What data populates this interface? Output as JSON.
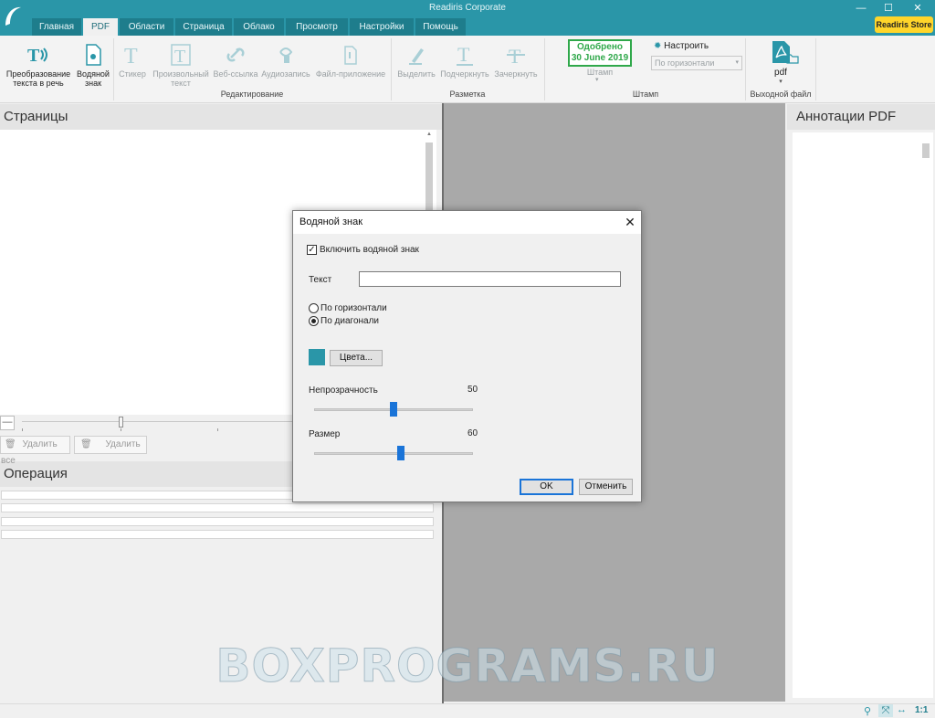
{
  "app": {
    "title": "Readiris Corporate",
    "store": "Readiris Store"
  },
  "tabs": [
    "Главная",
    "PDF",
    "Области",
    "Страница",
    "Облако",
    "Просмотр",
    "Настройки",
    "Помощь"
  ],
  "ribbon": {
    "tts": "Преобразование текста в речь",
    "watermark": "Водяной знак",
    "sticker": "Стикер",
    "freetext": "Произвольный текст",
    "weblink": "Веб-ссылка",
    "audio": "Аудиозапись",
    "fileapp": "Файл-приложение",
    "group_edit": "Редактирование",
    "highlight": "Выделить",
    "underline": "Подчеркнуть",
    "strike": "Зачеркнуть",
    "group_markup": "Разметка",
    "stamp_line1": "Одобрено",
    "stamp_line2": "30 June 2019",
    "stamp_label": "Штамп",
    "configure": "Настроить",
    "orientation_select": "По горизонтали",
    "group_stamp": "Штамп",
    "output_format": "pdf",
    "group_output": "Выходной файл"
  },
  "left": {
    "pages_title": "Страницы",
    "delete_all": "Удалить все",
    "delete": "Удалить",
    "operation_title": "Операция"
  },
  "right": {
    "title": "Аннотации PDF"
  },
  "dialog": {
    "title": "Водяной знак",
    "enable_label": "Включить водяной знак",
    "enabled": true,
    "text_label": "Текст",
    "text_value": "",
    "horizontal": "По горизонтали",
    "diagonal": "По диагонали",
    "orientation": "diagonal",
    "color": "#2a96a8",
    "colors_button": "Цвета...",
    "opacity_label": "Непрозрачность",
    "opacity_value": "50",
    "size_label": "Размер",
    "size_value": "60",
    "ok": "OK",
    "cancel": "Отменить"
  },
  "status": {
    "zoom": "1:1"
  },
  "watermark_text": "BOXPROGRAMS.RU",
  "colors": {
    "accent": "#2a96a8",
    "store": "#ffd52a",
    "stamp": "#2fa84a",
    "slider": "#1a74d8"
  }
}
